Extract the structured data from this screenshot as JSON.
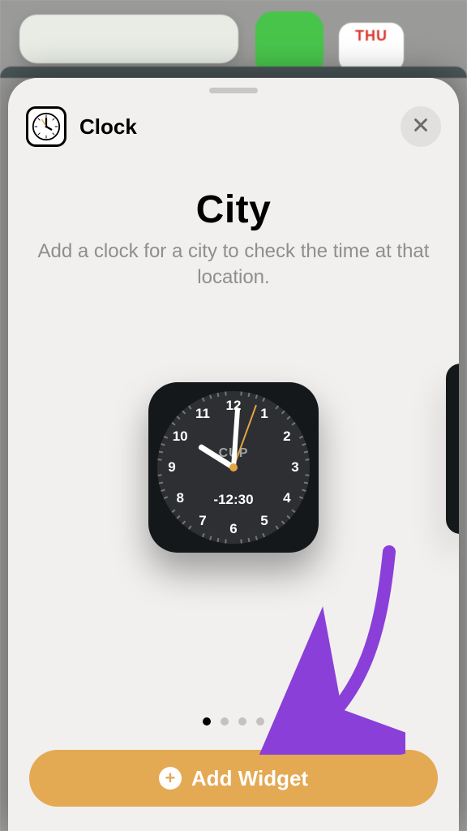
{
  "background": {
    "calendar_day_abbr": "THU"
  },
  "sheet": {
    "app_name": "Clock",
    "title": "City",
    "subtitle": "Add a clock for a city to check the time at that location.",
    "widget_preview": {
      "city_abbr": "CUP",
      "tz_offset": "-12:30",
      "numerals": [
        "12",
        "1",
        "2",
        "3",
        "4",
        "5",
        "6",
        "7",
        "8",
        "9",
        "10",
        "11"
      ]
    },
    "page_dots": {
      "count": 4,
      "active_index": 0
    },
    "add_button_label": "Add Widget"
  },
  "colors": {
    "accent": "#e4a953",
    "sheet_bg": "#f1f0ef",
    "clock_face": "#2d2f32"
  }
}
